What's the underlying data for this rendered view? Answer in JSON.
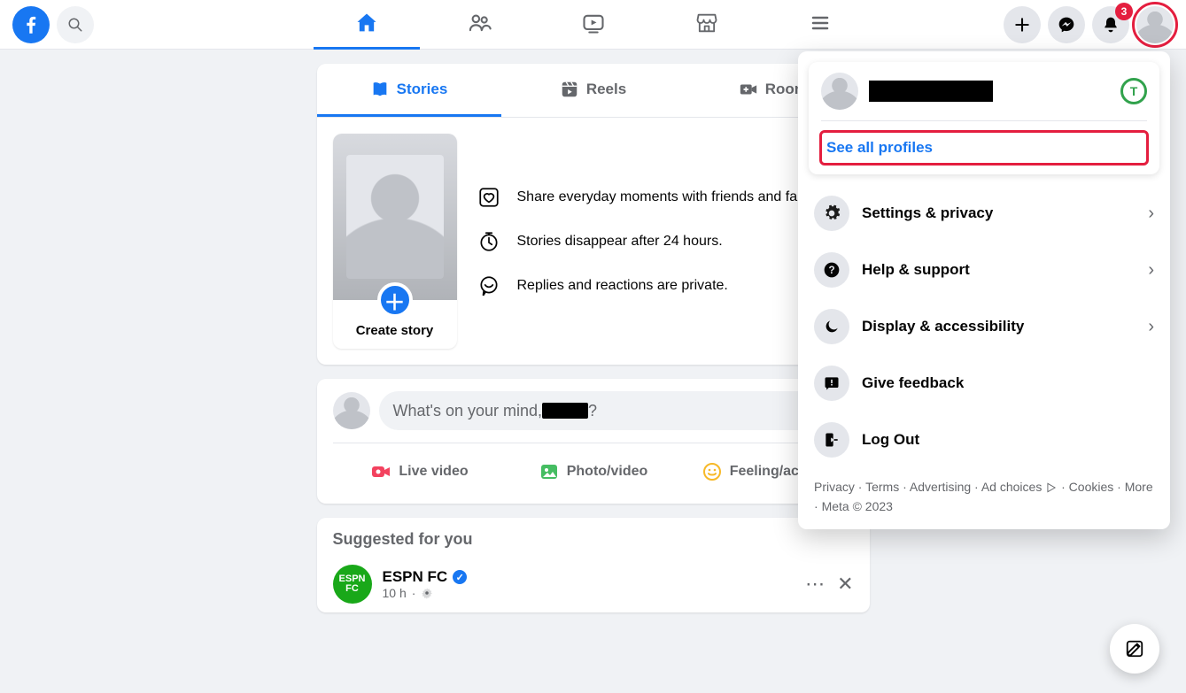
{
  "nav": {
    "notifications_badge": "3"
  },
  "story_tabs": {
    "stories": "Stories",
    "reels": "Reels",
    "rooms": "Rooms"
  },
  "create_story_label": "Create story",
  "story_info": [
    "Share everyday moments with friends and family.",
    "Stories disappear after 24 hours.",
    "Replies and reactions are private."
  ],
  "composer": {
    "prompt_prefix": "What's on your mind, ",
    "prompt_suffix": "?",
    "live_video": "Live video",
    "photo_video": "Photo/video",
    "feeling": "Feeling/activity"
  },
  "suggested": {
    "title": "Suggested for you",
    "page_name": "ESPN FC",
    "page_avatar_text": "ESPN FC",
    "time": "10 h"
  },
  "dropdown": {
    "see_all_profiles": "See all profiles",
    "switch_letter": "T",
    "items": [
      {
        "label": "Settings & privacy",
        "chevron": true,
        "icon": "gear"
      },
      {
        "label": "Help & support",
        "chevron": true,
        "icon": "help"
      },
      {
        "label": "Display & accessibility",
        "chevron": true,
        "icon": "moon"
      },
      {
        "label": "Give feedback",
        "chevron": false,
        "icon": "feedback"
      },
      {
        "label": "Log Out",
        "chevron": false,
        "icon": "logout"
      }
    ],
    "footer_links": [
      "Privacy",
      "Terms",
      "Advertising",
      "Ad choices",
      "Cookies",
      "More"
    ],
    "footer_suffix": "Meta © 2023"
  }
}
